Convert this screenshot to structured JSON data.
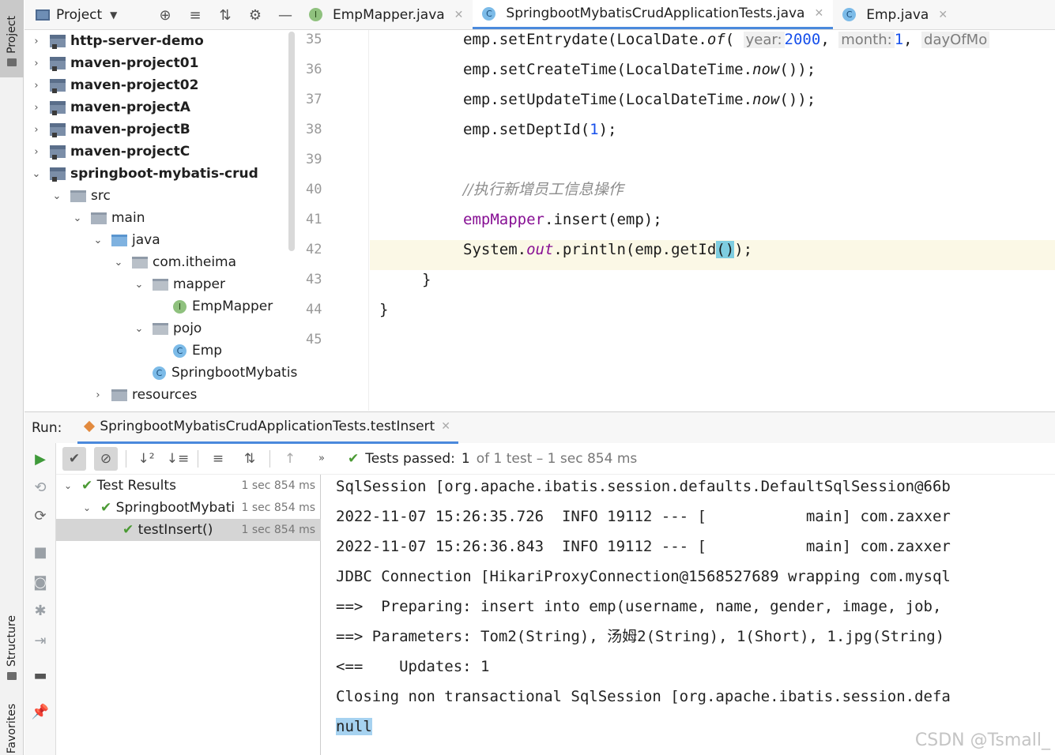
{
  "side_tabs": {
    "project": "Project",
    "structure": "Structure",
    "favorites": "Favorites"
  },
  "project_panel": {
    "title": "Project",
    "tree": [
      {
        "label": "http-server-demo"
      },
      {
        "label": "maven-project01"
      },
      {
        "label": "maven-project02"
      },
      {
        "label": "maven-projectA"
      },
      {
        "label": "maven-projectB"
      },
      {
        "label": "maven-projectC"
      },
      {
        "label": "springboot-mybatis-crud"
      },
      {
        "label": "src"
      },
      {
        "label": "main"
      },
      {
        "label": "java"
      },
      {
        "label": "com.itheima"
      },
      {
        "label": "mapper"
      },
      {
        "label": "EmpMapper"
      },
      {
        "label": "pojo"
      },
      {
        "label": "Emp"
      },
      {
        "label": "SpringbootMybatis"
      },
      {
        "label": "resources"
      }
    ]
  },
  "editor": {
    "tabs": [
      {
        "label": "EmpMapper.java",
        "icon": "I"
      },
      {
        "label": "SpringbootMybatisCrudApplicationTests.java",
        "icon": "C"
      },
      {
        "label": "Emp.java",
        "icon": "C"
      }
    ],
    "line_numbers": [
      "35",
      "36",
      "37",
      "38",
      "39",
      "40",
      "41",
      "42",
      "43",
      "44",
      "45"
    ],
    "code": {
      "l35_a": "emp.setEntrydate(LocalDate.",
      "l35_of": "of",
      "l35_b": "( ",
      "l35_hint_year": "year:",
      "l35_year": "2000",
      "l35_c": ", ",
      "l35_hint_month": "month:",
      "l35_month": "1",
      "l35_d": ", ",
      "l35_hint_day": "dayOfMo",
      "l36_a": "emp.setCreateTime(LocalDateTime.",
      "l36_now": "now",
      "l36_b": "());",
      "l37_a": "emp.setUpdateTime(LocalDateTime.",
      "l37_now": "now",
      "l37_b": "());",
      "l38_a": "emp.setDeptId(",
      "l38_num": "1",
      "l38_b": ");",
      "l40_comment": "//执行新增员工信息操作",
      "l41_field": "empMapper",
      "l41_rest": ".insert(emp);",
      "l42_a": "System.",
      "l42_out": "out",
      "l42_b": ".println(emp.getId",
      "l42_paren": "()",
      "l42_c": ");",
      "l43": "}",
      "l44": "}"
    }
  },
  "run": {
    "label": "Run:",
    "tab": "SpringbootMybatisCrudApplicationTests.testInsert",
    "status_prefix": "Tests passed:",
    "status_count": "1",
    "status_rest": "of 1 test – 1 sec 854 ms",
    "results": [
      {
        "label": "Test Results",
        "time": "1 sec 854 ms"
      },
      {
        "label": "SpringbootMybati",
        "time": "1 sec 854 ms"
      },
      {
        "label": "testInsert()",
        "time": "1 sec 854 ms"
      }
    ],
    "console": [
      "SqlSession [org.apache.ibatis.session.defaults.DefaultSqlSession@66b",
      "2022-11-07 15:26:35.726  INFO 19112 --- [           main] com.zaxxer",
      "2022-11-07 15:26:36.843  INFO 19112 --- [           main] com.zaxxer",
      "JDBC Connection [HikariProxyConnection@1568527689 wrapping com.mysql",
      "==>  Preparing: insert into emp(username, name, gender, image, job,",
      "==> Parameters: Tom2(String), 汤姆2(String), 1(Short), 1.jpg(String)",
      "<==    Updates: 1",
      "Closing non transactional SqlSession [org.apache.ibatis.session.defa",
      "null"
    ]
  },
  "watermark": "CSDN @Tsmall_"
}
